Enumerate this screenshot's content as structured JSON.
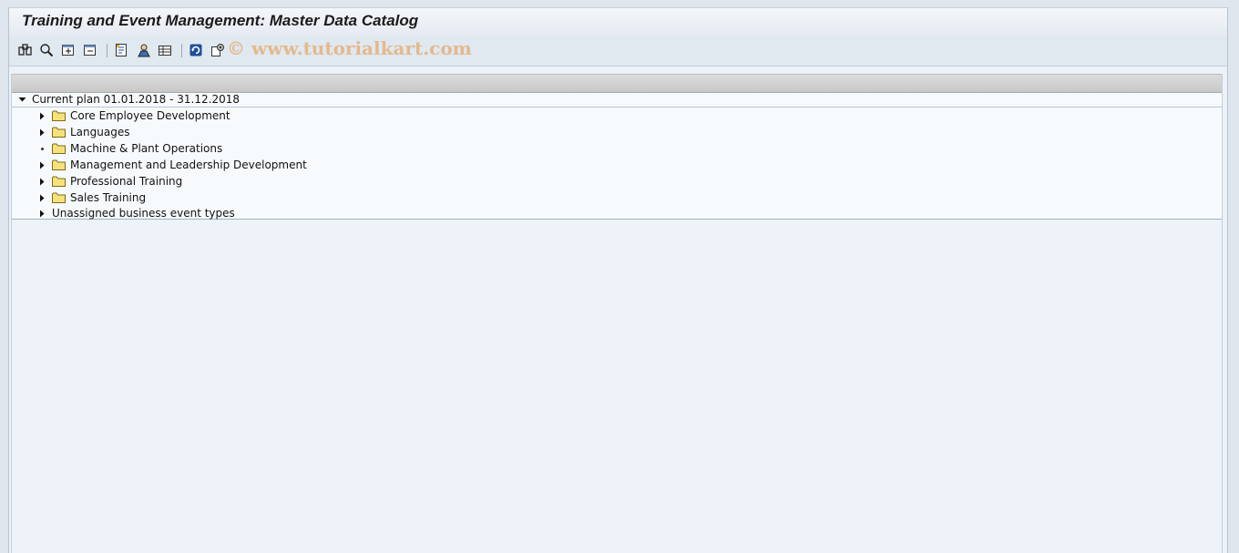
{
  "window": {
    "title": "Training and Event Management: Master Data Catalog"
  },
  "toolbar": {
    "watermark": "© www.tutorialkart.com",
    "buttons": [
      "display-icon",
      "find-icon",
      "expand-all-icon",
      "collapse-all-icon",
      "details-icon",
      "person-icon",
      "list-icon",
      "refresh-icon",
      "settings-icon"
    ]
  },
  "tree": {
    "root": {
      "label": "Current plan 01.01.2018 - 31.12.2018",
      "expanded": true
    },
    "items": [
      {
        "label": "Core Employee Development",
        "expandable": true
      },
      {
        "label": "Languages",
        "expandable": true
      },
      {
        "label": "Machine & Plant Operations",
        "expandable": false
      },
      {
        "label": "Management and Leadership Development",
        "expandable": true
      },
      {
        "label": "Professional Training",
        "expandable": true
      },
      {
        "label": "Sales Training",
        "expandable": true
      }
    ],
    "unassigned": {
      "label": "Unassigned business event types",
      "expandable": true
    }
  },
  "colors": {
    "folder": "#f6e27a",
    "folder_border": "#7c6a1c",
    "icon_blue": "#1f4f9a"
  }
}
